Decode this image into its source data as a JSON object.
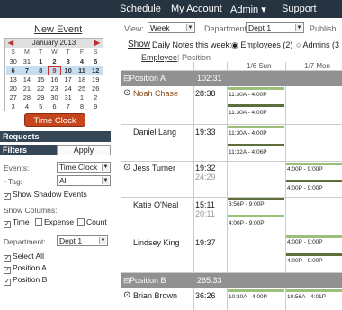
{
  "topbar": {
    "items": [
      "Schedule",
      "My Account",
      "Admin ▾",
      "Support"
    ]
  },
  "left": {
    "new_event": "New Event",
    "calendar": {
      "title": "January 2013",
      "prev": "◀",
      "next": "▶",
      "dow": [
        "S",
        "M",
        "T",
        "W",
        "T",
        "F",
        "S"
      ],
      "weeks": [
        [
          "30",
          "31",
          "1",
          "2",
          "3",
          "4",
          "5"
        ],
        [
          "6",
          "7",
          "8",
          "9",
          "10",
          "11",
          "12"
        ],
        [
          "13",
          "14",
          "15",
          "16",
          "17",
          "18",
          "19"
        ],
        [
          "20",
          "21",
          "22",
          "23",
          "24",
          "25",
          "26"
        ],
        [
          "27",
          "28",
          "29",
          "30",
          "31",
          "1",
          "2"
        ],
        [
          "3",
          "4",
          "5",
          "6",
          "7",
          "8",
          "9"
        ]
      ]
    },
    "time_clock": "Time Clock",
    "requests": "Requests",
    "filters": "Filters",
    "apply": "Apply",
    "events_label": "Events:",
    "events_value": "Time Clock",
    "tag_label": "~Tag:",
    "tag_value": "All",
    "show_shadow": "Show Shadow Events",
    "show_columns": "Show Columns:",
    "col_time": "Time",
    "col_expense": "Expense",
    "col_count": "Count",
    "dept_label": "Department:",
    "dept_value": "Dept 1",
    "select_all": "Select All",
    "position_a": "Position A",
    "position_b": "Position B"
  },
  "main": {
    "view_label": "View:",
    "view_value": "Week",
    "dept_label": "Department:",
    "dept_value": "Dept 1",
    "publish": "Publish:",
    "show": "Show",
    "daily_notes": "Daily Notes this week:",
    "employees": "Employees (2)",
    "admins": "Admins (3",
    "tab_employee": "Employee",
    "tab_sep": "|",
    "tab_position": "Position",
    "days": [
      "1/6 Sun",
      "1/7 Mon"
    ],
    "positions": [
      {
        "name": "Position A",
        "hours": "102:31"
      },
      {
        "name": "Position B",
        "hours": "265:33"
      }
    ],
    "employees_rows": [
      {
        "name": "Noah Chase",
        "clock": "⊙",
        "hours": "28:38",
        "hours2": "",
        "sun": [
          "11:30A - 4:00P",
          "11:30A - 4:00P"
        ],
        "mon": []
      },
      {
        "name": "Daniel Lang",
        "clock": "",
        "hours": "19:33",
        "hours2": "",
        "sun": [
          "11:30A - 4:00P",
          "11:32A - 4:06P"
        ],
        "mon": []
      },
      {
        "name": "Jess Turner",
        "clock": "⊙",
        "hours": "19:32",
        "hours2": "24:29",
        "sun": [],
        "mon": [
          "4:00P - 9:00P",
          "4:00P - 9:00P"
        ]
      },
      {
        "name": "Katie O'Neal",
        "clock": "",
        "hours": "15:11",
        "hours2": "20:11",
        "sun": [
          "3:56P - 9:00P",
          "4:00P - 9:00P"
        ],
        "mon": []
      },
      {
        "name": "Lindsey King",
        "clock": "",
        "hours": "19:37",
        "hours2": "",
        "sun": [],
        "mon": [
          "4:00P - 9:00P",
          "4:00P - 9:00P"
        ]
      },
      {
        "name": "Brian Brown",
        "clock": "⊙",
        "hours": "36:26",
        "hours2": "",
        "sun": [
          "10:30A - 4:00P"
        ],
        "mon": [
          "10:56A - 4:01P"
        ]
      }
    ]
  },
  "colors": {
    "topbar": "#263442",
    "section": "#354757",
    "time_clock": "#c5461c",
    "week_highlight": "#c7ddf0",
    "position_row": "#919191",
    "shift_green": "#9cc07a",
    "shift_dark": "#5e6e3a"
  }
}
